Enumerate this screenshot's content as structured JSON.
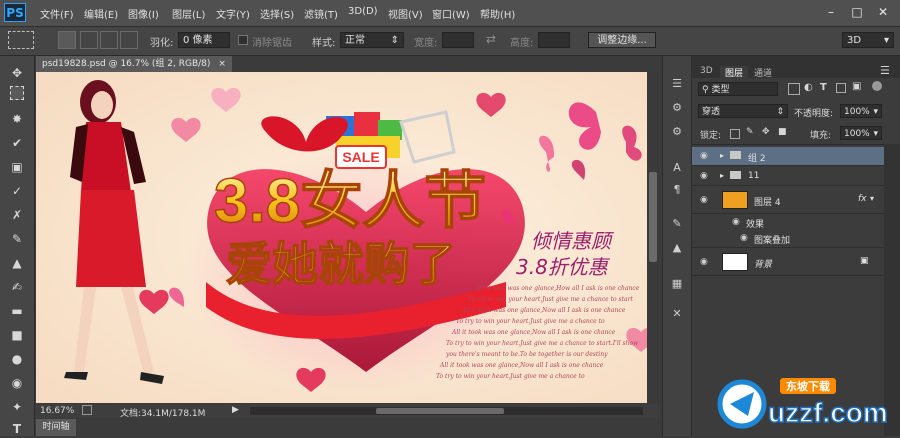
{
  "app": {
    "logo": "PS",
    "menu": [
      "文件(F)",
      "编辑(E)",
      "图像(I)",
      "图层(L)",
      "文字(Y)",
      "选择(S)",
      "滤镜(T)",
      "3D(D)",
      "视图(V)",
      "窗口(W)",
      "帮助(H)"
    ],
    "window_controls": [
      "minimize-icon",
      "restore-icon",
      "close-icon"
    ]
  },
  "options": {
    "feather_label": "羽化:",
    "feather_value": "0 像素",
    "antialias_label": "消除锯齿",
    "style_label": "样式:",
    "style_value": "正常",
    "width_label": "宽度:",
    "height_label": "高度:",
    "refine_edge": "调整边缘...",
    "workspace": "3D"
  },
  "document": {
    "tab": "psd19828.psd @ 16.7% (组 2, RGB/8)",
    "zoom": "16.67%",
    "doc_info": "文档:34.1M/178.1M",
    "timeline_tab": "时间轴"
  },
  "artwork": {
    "headline1": "3.8女人节",
    "headline2": "爱她就购了",
    "tagline1": "倾情惠顾",
    "tagline2": "3.8折优惠",
    "sale_badge": "SALE",
    "poem": [
      "All it took was one glance,How all I ask is one chance",
      "To try to win your heart.Just give me a chance to start",
      "All it took was one glance,Now all I ask is one chance",
      "To try to win your heart.Just give me a chance to",
      "All it took was one glance,Now all I ask is one chance",
      "To try to win your heart.Just give me a chance to start.I'll show",
      "you there's meant to be.To be together is our destiny",
      "All it took was one glance,Now all I ask is one chance",
      "To try to win your heart.Just give me a chance to"
    ]
  },
  "layers_panel": {
    "tabs": [
      "3D",
      "图层",
      "通道"
    ],
    "filter_value": "类型",
    "blend_mode": "穿透",
    "opacity_label": "不透明度:",
    "opacity_value": "100%",
    "lock_label": "锁定:",
    "fill_label": "填充:",
    "fill_value": "100%",
    "layers": [
      {
        "name": "组 2",
        "kind": "group",
        "selected": true
      },
      {
        "name": "11",
        "kind": "group",
        "selected": false
      },
      {
        "name": "图层 4",
        "kind": "layer",
        "thumb_color": "#f0a020",
        "fx": "fx",
        "selected": false
      },
      {
        "name": "效果",
        "kind": "effect",
        "selected": false
      },
      {
        "name": "图案叠加",
        "kind": "effect-item",
        "selected": false
      },
      {
        "name": "背景",
        "kind": "background",
        "thumb_color": "#ffffff",
        "selected": false
      }
    ]
  },
  "watermark": {
    "brand": "uzzf.com",
    "tag": "东坡下载"
  },
  "colors": {
    "accent": "#31a8ff",
    "selected_layer": "#5d6f85",
    "canvas_bg": "#fbead6"
  }
}
